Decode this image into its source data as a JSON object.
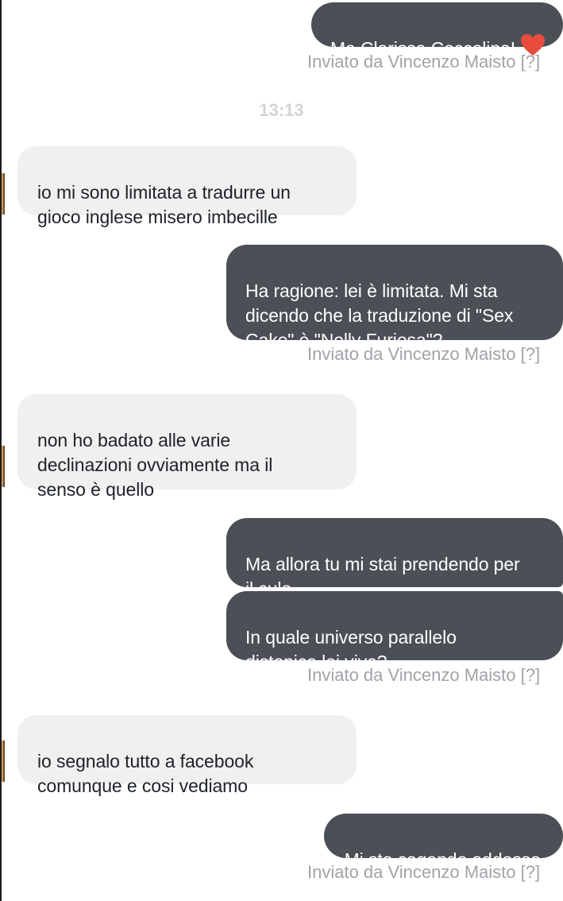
{
  "colors": {
    "outgoing_bubble": "#4b4f56",
    "incoming_bubble": "#f1f0f0",
    "meta_text": "#a0a3a8",
    "timestamp_text": "#d2d4d8",
    "heart": "#e74c3c"
  },
  "timestamp": "13:13",
  "messages": [
    {
      "direction": "out",
      "text": "Ma Clarissa Coccolina!",
      "icon": "red-heart-icon",
      "sent_label": "Inviato da Vincenzo Maisto [?]"
    },
    {
      "direction": "in",
      "text": "io mi sono limitata a tradurre un\ngioco inglese misero imbecille"
    },
    {
      "direction": "out",
      "text": "Ha ragione: lei è limitata. Mi sta\ndicendo che la traduzione di \"Sex\nCake\" è \"Nelly Furiosa\"?",
      "sent_label": "Inviato da Vincenzo Maisto [?]"
    },
    {
      "direction": "in",
      "text": "non ho badato alle varie\ndeclinazioni ovviamente ma il\nsenso è quello"
    },
    {
      "direction": "out",
      "text": "Ma allora tu mi stai prendendo per\nil culo."
    },
    {
      "direction": "out",
      "text": "In quale universo parallelo\ndistopico lei vive?",
      "sent_label": "Inviato da Vincenzo Maisto [?]"
    },
    {
      "direction": "in",
      "text": "io segnalo tutto a facebook\ncomunque e cosi vediamo"
    },
    {
      "direction": "out",
      "text": "Mi sto cagando addosso.",
      "sent_label": "Inviato da Vincenzo Maisto [?]"
    }
  ]
}
